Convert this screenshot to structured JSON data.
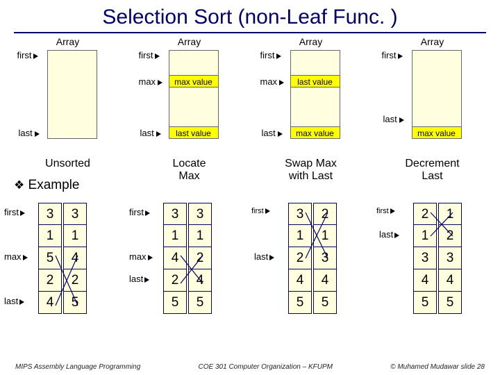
{
  "title": "Selection Sort (non-Leaf Func. )",
  "arrays": {
    "label": "Array",
    "first": "first",
    "max": "max",
    "last": "last",
    "maxval": "max value",
    "lastval": "last value"
  },
  "captions": {
    "c0": "Unsorted",
    "c1a": "Locate",
    "c1b": "Max",
    "c2a": "Swap Max",
    "c2b": "with Last",
    "c3a": "Decrement",
    "c3b": "Last"
  },
  "example": "Example",
  "ptrs": {
    "first": "first",
    "max": "max",
    "last": "last"
  },
  "cols": {
    "g0a": [
      "3",
      "1",
      "5",
      "2",
      "4"
    ],
    "g0b": [
      "3",
      "1",
      "4",
      "2",
      "5"
    ],
    "g1a": [
      "3",
      "1",
      "4",
      "2",
      "5"
    ],
    "g1b": [
      "3",
      "1",
      "2",
      "4",
      "5"
    ],
    "g2a": [
      "3",
      "1",
      "2",
      "4",
      "5"
    ],
    "g2b": [
      "2",
      "1",
      "3",
      "4",
      "5"
    ],
    "g3a": [
      "2",
      "1",
      "3",
      "4",
      "5"
    ],
    "g3b": [
      "1",
      "2",
      "3",
      "4",
      "5"
    ]
  },
  "footer": {
    "left": "MIPS Assembly Language Programming",
    "mid": "COE 301 Computer Organization – KFUPM",
    "right": "© Muhamed Mudawar   slide 28"
  }
}
